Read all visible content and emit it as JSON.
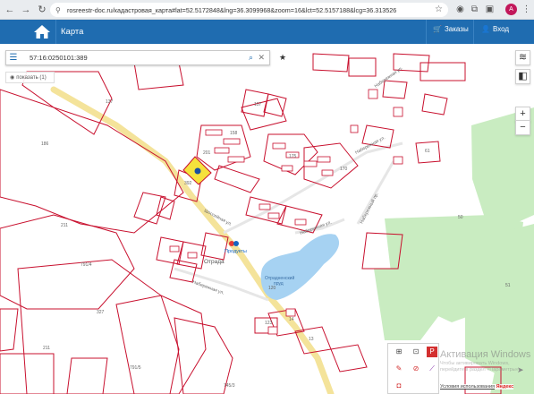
{
  "browser": {
    "url": "rosreestr-doc.ru/кадастровая_карта#lat=52.5172848&lng=36.3099968&zoom=16&lct=52.5157188&lcg=36.313526",
    "avatar_letter": "A"
  },
  "header": {
    "title": "Карта",
    "orders_label": "Заказы",
    "login_label": "Вход"
  },
  "search": {
    "value": "57:16:0250101:389",
    "show_label": "показать (1)"
  },
  "map": {
    "labels": {
      "l137": "137",
      "l157": "157",
      "l186": "186",
      "l211a": "211",
      "l211b": "211",
      "l327": "327",
      "l791_4": "791/4",
      "l791_5": "791/5",
      "l745_3": "745/3",
      "l50": "50",
      "l51": "51",
      "l61": "61",
      "l392": "392",
      "l201": "201",
      "l158": "158",
      "l175": "175",
      "l170": "170",
      "l14": "14",
      "l13": "13",
      "l120": "120",
      "l123": "123",
      "street1": "Шоссейная ул.",
      "street2": "Набережная ул.",
      "street3": "Набережная ул.",
      "street4": "Набережный пр.",
      "street5": "Набережная ул.",
      "street6": "Набережная ул.",
      "village": "Отрада",
      "shop": "Продукты",
      "pond1": "Отрадненский",
      "pond2": "пруд"
    },
    "selected_parcel_color": "#f5e23c",
    "parcel_color": "#c8102e",
    "forest_color": "#c8ebc0",
    "road_color": "#f6e39a"
  },
  "watermark": {
    "title": "Активация Windows",
    "subtitle": "Чтобы активировать Windows, перейдите в раздел «Параметры»."
  },
  "attribution": {
    "text": "Условия использования",
    "brand": "Яндекс"
  },
  "icons": [
    "menu-icon",
    "search-icon",
    "clear-icon",
    "star-icon",
    "layers-icon",
    "basemap-icon",
    "zoom-in-icon",
    "zoom-out-icon",
    "cart-icon",
    "login-icon",
    "home-icon",
    "send-icon"
  ]
}
